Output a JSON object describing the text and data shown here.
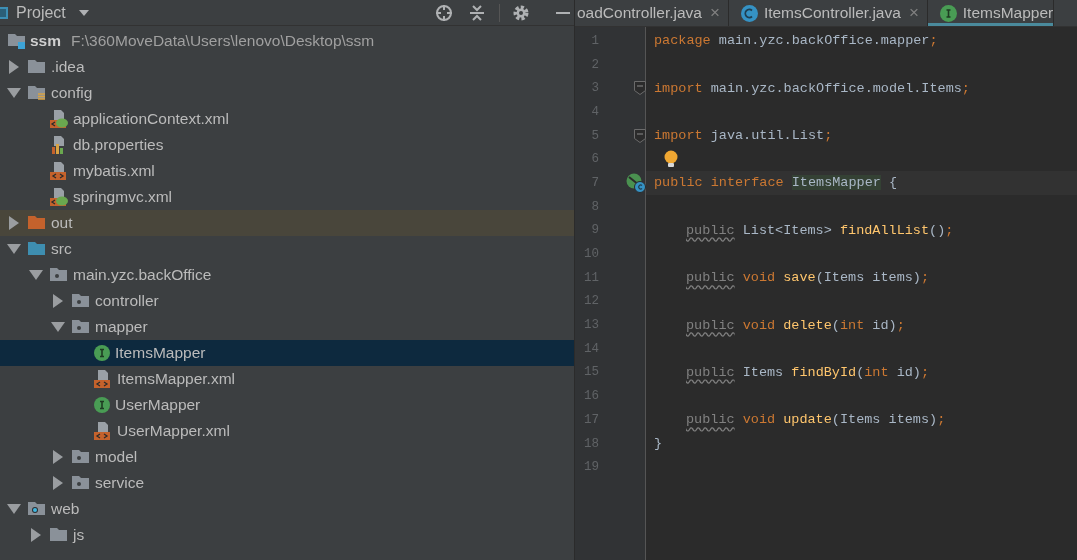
{
  "project_panel": {
    "title": "Project",
    "tree": {
      "name": "ssm",
      "path": "F:\\360MoveData\\Users\\lenovo\\Desktop\\ssm",
      "kind": "module",
      "selected": false,
      "children": [
        {
          "name": ".idea",
          "kind": "folder",
          "expanded": false,
          "selected": false
        },
        {
          "name": "config",
          "kind": "resource-folder",
          "expanded": true,
          "selected": false,
          "children": [
            {
              "name": "applicationContext.xml",
              "kind": "spring-xml",
              "selected": false
            },
            {
              "name": "db.properties",
              "kind": "properties",
              "selected": false
            },
            {
              "name": "mybatis.xml",
              "kind": "xml",
              "selected": false
            },
            {
              "name": "springmvc.xml",
              "kind": "spring-xml",
              "selected": false
            }
          ]
        },
        {
          "name": "out",
          "kind": "excluded-folder",
          "expanded": false,
          "selected": false
        },
        {
          "name": "src",
          "kind": "source-folder",
          "expanded": true,
          "selected": false,
          "children": [
            {
              "name": "main.yzc.backOffice",
              "kind": "package",
              "expanded": true,
              "selected": false,
              "children": [
                {
                  "name": "controller",
                  "kind": "package",
                  "expanded": false,
                  "selected": false
                },
                {
                  "name": "mapper",
                  "kind": "package",
                  "expanded": true,
                  "selected": false,
                  "children": [
                    {
                      "name": "ItemsMapper",
                      "kind": "interface",
                      "selected": true
                    },
                    {
                      "name": "ItemsMapper.xml",
                      "kind": "xml",
                      "selected": false
                    },
                    {
                      "name": "UserMapper",
                      "kind": "interface",
                      "selected": false
                    },
                    {
                      "name": "UserMapper.xml",
                      "kind": "xml",
                      "selected": false
                    }
                  ]
                },
                {
                  "name": "model",
                  "kind": "package",
                  "expanded": false,
                  "selected": false
                },
                {
                  "name": "service",
                  "kind": "package",
                  "expanded": false,
                  "selected": false
                }
              ]
            }
          ]
        },
        {
          "name": "web",
          "kind": "web-folder",
          "expanded": true,
          "selected": false,
          "children": [
            {
              "name": "js",
              "kind": "folder",
              "expanded": false,
              "selected": false
            }
          ]
        }
      ]
    }
  },
  "editor": {
    "tabs": [
      {
        "label": "oadController.java",
        "kind": "plain",
        "close": "×",
        "selected": false
      },
      {
        "label": "ItemsController.java",
        "kind": "class",
        "close": "×",
        "selected": false
      },
      {
        "label": "ItemsMapper",
        "kind": "interface",
        "selected": true
      }
    ],
    "lines": [
      {
        "number": "1",
        "tokens": [
          {
            "kind": "keyword",
            "text": "package"
          },
          {
            "kind": "plain",
            "text": " main.yzc.backOffice.mapper"
          },
          {
            "kind": "punct",
            "text": ";"
          }
        ]
      },
      {
        "number": "2"
      },
      {
        "number": "3",
        "fold_marker": true,
        "tokens": [
          {
            "kind": "keyword",
            "text": "import"
          },
          {
            "kind": "plain",
            "text": " main.yzc.backOffice.model.Items"
          },
          {
            "kind": "punct",
            "text": ";"
          }
        ]
      },
      {
        "number": "4"
      },
      {
        "number": "5",
        "fold_marker": true,
        "tokens": [
          {
            "kind": "keyword",
            "text": "import"
          },
          {
            "kind": "plain",
            "text": " java.util.List"
          },
          {
            "kind": "punct",
            "text": ";"
          }
        ]
      },
      {
        "number": "6",
        "bulb": true
      },
      {
        "number": "7",
        "current": true,
        "implemented_marker": true,
        "tokens": [
          {
            "kind": "keyword",
            "text": "public interface "
          },
          {
            "kind": "highlight",
            "text": "ItemsMapper"
          },
          {
            "kind": "plain",
            "text": " {"
          }
        ]
      },
      {
        "number": "8"
      },
      {
        "number": "9",
        "indented": true,
        "tokens": [
          {
            "kind": "weak",
            "text": "public"
          },
          {
            "kind": "plain",
            "text": " List<Items> "
          },
          {
            "kind": "method",
            "text": "findAllList"
          },
          {
            "kind": "plain",
            "text": "()"
          },
          {
            "kind": "punct",
            "text": ";"
          }
        ]
      },
      {
        "number": "10"
      },
      {
        "number": "11",
        "indented": true,
        "tokens": [
          {
            "kind": "weak",
            "text": "public"
          },
          {
            "kind": "keyword",
            "text": " void "
          },
          {
            "kind": "method",
            "text": "save"
          },
          {
            "kind": "plain",
            "text": "(Items items)"
          },
          {
            "kind": "punct",
            "text": ";"
          }
        ]
      },
      {
        "number": "12"
      },
      {
        "number": "13",
        "indented": true,
        "tokens": [
          {
            "kind": "weak",
            "text": "public"
          },
          {
            "kind": "keyword",
            "text": " void "
          },
          {
            "kind": "method",
            "text": "delete"
          },
          {
            "kind": "plain",
            "text": "("
          },
          {
            "kind": "keyword",
            "text": "int"
          },
          {
            "kind": "plain",
            "text": " id)"
          },
          {
            "kind": "punct",
            "text": ";"
          }
        ]
      },
      {
        "number": "14"
      },
      {
        "number": "15",
        "indented": true,
        "tokens": [
          {
            "kind": "weak",
            "text": "public"
          },
          {
            "kind": "plain",
            "text": " Items "
          },
          {
            "kind": "method",
            "text": "findById"
          },
          {
            "kind": "plain",
            "text": "("
          },
          {
            "kind": "keyword",
            "text": "int"
          },
          {
            "kind": "plain",
            "text": " id)"
          },
          {
            "kind": "punct",
            "text": ";"
          }
        ]
      },
      {
        "number": "16"
      },
      {
        "number": "17",
        "indented": true,
        "tokens": [
          {
            "kind": "weak",
            "text": "public"
          },
          {
            "kind": "keyword",
            "text": " void "
          },
          {
            "kind": "method",
            "text": "update"
          },
          {
            "kind": "plain",
            "text": "(Items items)"
          },
          {
            "kind": "punct",
            "text": ";"
          }
        ]
      },
      {
        "number": "18",
        "tokens": [
          {
            "kind": "plain",
            "text": "}"
          }
        ]
      },
      {
        "number": "19"
      }
    ]
  }
}
